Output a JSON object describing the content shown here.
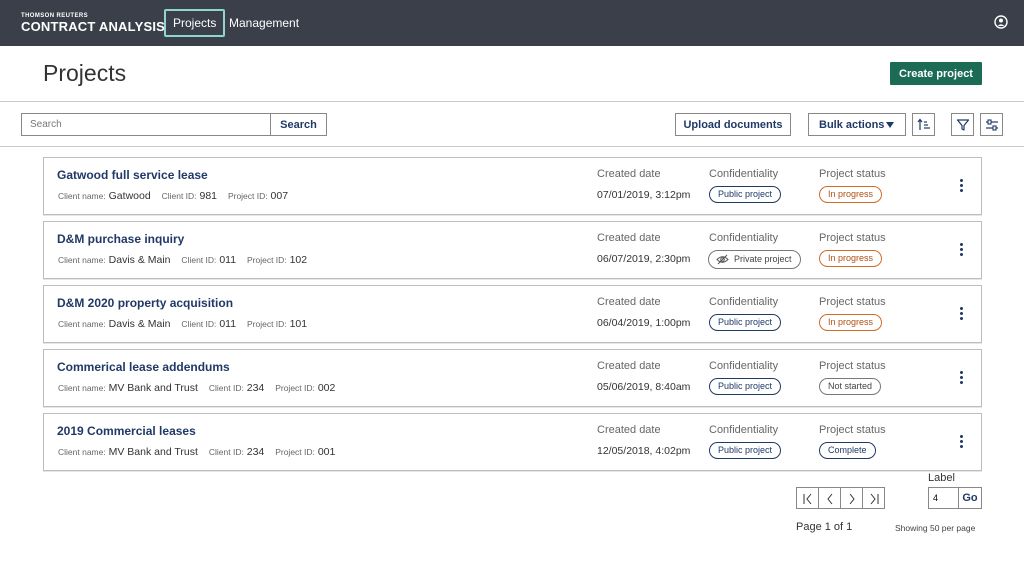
{
  "brand": {
    "top": "THOMSON REUTERS",
    "main": "CONTRACT ANALYSIS"
  },
  "nav": {
    "projects": "Projects",
    "management": "Management"
  },
  "page_title": "Projects",
  "create_button": "Create project",
  "search": {
    "placeholder": "Search",
    "button": "Search"
  },
  "toolbar": {
    "upload": "Upload documents",
    "bulk": "Bulk actions"
  },
  "labels": {
    "client_name": "Client name:",
    "client_id": "Client ID:",
    "project_id": "Project ID:",
    "created": "Created date",
    "confidentiality": "Confidentiality",
    "status": "Project status"
  },
  "projects": [
    {
      "title": "Gatwood full service lease",
      "client_name": "Gatwood",
      "client_id": "981",
      "project_id": "007",
      "created": "07/01/2019, 3:12pm",
      "confidentiality": "Public project",
      "status": "In progress"
    },
    {
      "title": "D&M purchase inquiry",
      "client_name": "Davis & Main",
      "client_id": "011",
      "project_id": "102",
      "created": "06/07/2019, 2:30pm",
      "confidentiality": "Private project",
      "status": "In progress"
    },
    {
      "title": "D&M 2020 property acquisition",
      "client_name": "Davis & Main",
      "client_id": "011",
      "project_id": "101",
      "created": "06/04/2019, 1:00pm",
      "confidentiality": "Public project",
      "status": "In progress"
    },
    {
      "title": "Commerical lease addendums",
      "client_name": "MV Bank and Trust",
      "client_id": "234",
      "project_id": "002",
      "created": "05/06/2019, 8:40am",
      "confidentiality": "Public project",
      "status": "Not started"
    },
    {
      "title": "2019 Commercial leases",
      "client_name": "MV Bank and Trust",
      "client_id": "234",
      "project_id": "001",
      "created": "12/05/2018, 4:02pm",
      "confidentiality": "Public project",
      "status": "Complete"
    }
  ],
  "pagination": {
    "label": "Label",
    "input_value": "4",
    "go": "Go",
    "page_text": "Page 1 of 1",
    "per_page": "Showing 50 per page"
  },
  "colors": {
    "topbar": "#3a3f4a",
    "primary": "#1c6b55",
    "link": "#1f3a66",
    "in_progress": "#d16a2a"
  }
}
